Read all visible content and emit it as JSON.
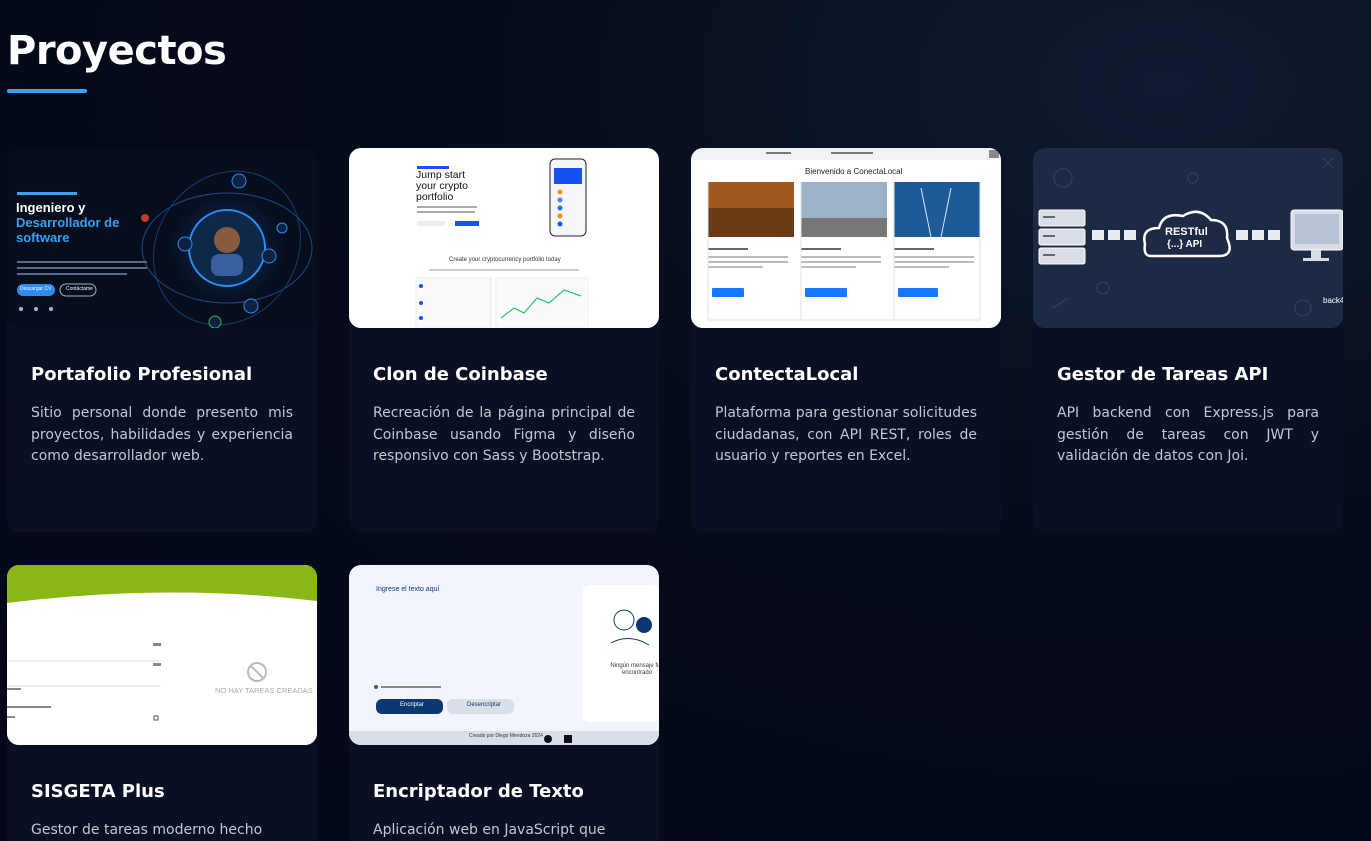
{
  "section": {
    "title": "Proyectos"
  },
  "colors": {
    "accent": "#3aa0f0",
    "card_bg": "#0a1023",
    "page_bg": "#04081a"
  },
  "projects": [
    {
      "title": "Portafolio Profesional",
      "description": "Sitio personal donde presento mis proyectos, habilidades y experiencia como desarrollador web.",
      "preview": {
        "heading_line1": "Ingeniero y",
        "heading_line2": "Desarrollador de",
        "heading_line3": "software",
        "primary_btn": "Descargar CV",
        "secondary_btn": "Contáctame",
        "social_icons": [
          "linkedin-icon",
          "github-icon",
          "email-icon"
        ]
      }
    },
    {
      "title": "Clon de Coinbase",
      "description": "Recreación de la página principal de Coinbase usando Figma y diseño responsivo con Sass y Bootstrap.",
      "preview": {
        "heading": "Jump start your crypto portfolio",
        "subheading": "Create your cryptocurrency portfolio today"
      }
    },
    {
      "title": "ContectaLocal",
      "description": "Plataforma para gestionar solicitudes ciudadanas, con API REST, roles de usuario y reportes en Excel.",
      "preview": {
        "heading": "Bienvenido a ConectaLocal"
      }
    },
    {
      "title": "Gestor de Tareas API",
      "description": "API backend con Express.js para gestión de tareas con JWT y validación de datos con Joi.",
      "preview": {
        "cloud_line1": "RESTful",
        "cloud_line2": "{...} API",
        "corner_text": "back4"
      }
    },
    {
      "title": "SISGETA Plus",
      "description": "Gestor de tareas moderno hecho",
      "preview": {
        "empty_text": "NO HAY TAREAS CREADAS"
      }
    },
    {
      "title": "Encriptador de Texto",
      "description": "Aplicación web en JavaScript que",
      "preview": {
        "placeholder": "Ingrese el texto aquí",
        "encrypt_btn": "Encriptar",
        "decrypt_btn": "Desencriptar",
        "empty_title": "Ningún mensaje fue encontrado",
        "footer_text": "Creado por Diego Mendoza 2024"
      }
    }
  ]
}
